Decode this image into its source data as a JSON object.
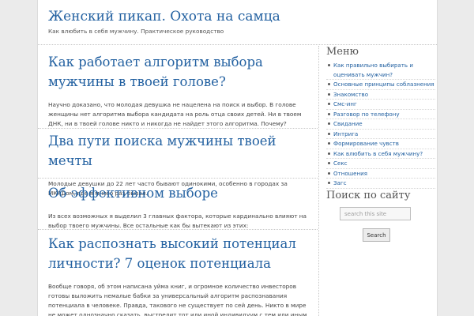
{
  "site": {
    "title": "Женский пикап. Охота на самца",
    "tagline": "Как влюбить в себя мужчину. Практическое руководство"
  },
  "posts": [
    {
      "title": "Как работает алгоритм выбора мужчины в твоей голове?",
      "excerpt": "Научно доказано, что молодая девушка не нацелена на поиск и выбор. В голове женщины нет алгоритма выбора кандидата на роль отца своих детей. Ни в твоем ДНК, ни в твоей голове никто и никогда не найдет этого алгоритма. Почему?"
    },
    {
      "title": "Два пути поиска мужчины твоей мечты",
      "excerpt": "Молодые девушки до 22 лет часто бывают одинокими, особенно в городах за МКАДом, где я много раз бывал."
    },
    {
      "title": "Об эффективном выборе",
      "excerpt": "Из всех возможных я выделил 3 главных фактора, которые кардинально влияют на выбор твоего мужчины. Все остальные как бы вытекают из этих:"
    },
    {
      "title": "Как распознать высокий потенциал личности? 7 оценок потенциала",
      "excerpt": "Вообще говоря, об этом написана уйма книг, и огромное количество инвесторов готовы выложить немалые бабки за универсальный алгоритм распознавания потенциала в человеке. Правда, такового не существует по сей день. Никто в мире не может однозначно сказать, выстрелит тот или иной индивидуум с тем или иным набором качеств или нет."
    }
  ],
  "sidebar": {
    "menu_title": "Меню",
    "menu_items": [
      "Как правильно выбирать и оценивать мужчин?",
      "Основные принципы соблазнения",
      "Знакомство",
      "Смс-инг",
      "Разговор по телефону",
      "Свидание",
      "Интрига",
      "Формирование чувств",
      "Как влюбить в себя мужчину?",
      "Секс",
      "Отношения",
      "Загс"
    ],
    "search_title": "Поиск по сайту",
    "search_placeholder": "search this site",
    "search_button": "Search"
  }
}
